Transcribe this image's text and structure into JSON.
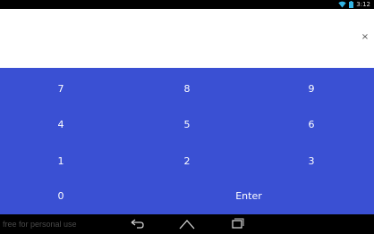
{
  "status_bar": {
    "time": "3:12",
    "icons": [
      "wifi-icon",
      "battery-icon"
    ]
  },
  "display": {
    "value": "",
    "clear_label": "×"
  },
  "keypad": {
    "rows": [
      [
        "7",
        "8",
        "9"
      ],
      [
        "4",
        "5",
        "6"
      ],
      [
        "1",
        "2",
        "3"
      ]
    ],
    "zero": "0",
    "enter": "Enter"
  },
  "nav_bar": {
    "watermark": "free for personal use",
    "buttons": [
      "back-icon",
      "home-icon",
      "recent-apps-icon"
    ]
  },
  "colors": {
    "keypad_bg": "#3a50d3",
    "display_bg": "#ffffff",
    "bars_bg": "#000000"
  }
}
